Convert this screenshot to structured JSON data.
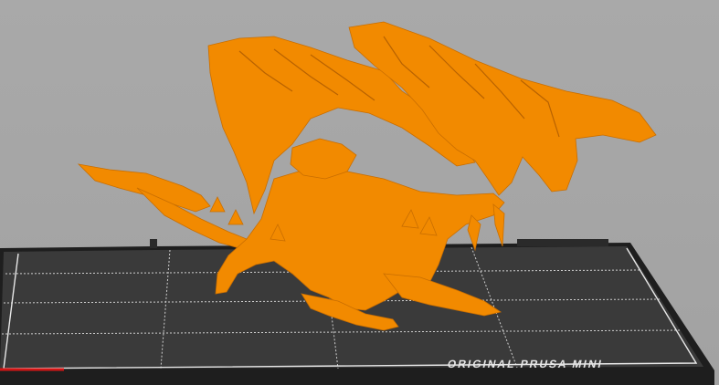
{
  "viewport": {
    "background_color": "#a6a6a6",
    "model_color": "#f28a00",
    "bed_color": "#3b3b3b",
    "bed_edge_color": "#1c1c1c",
    "grid_color": "#d9d9d9",
    "axis_x_color": "#d51515"
  },
  "bed": {
    "label": "ORIGINAL PRUSA MINI"
  },
  "model": {
    "icon": "dragon-model"
  }
}
